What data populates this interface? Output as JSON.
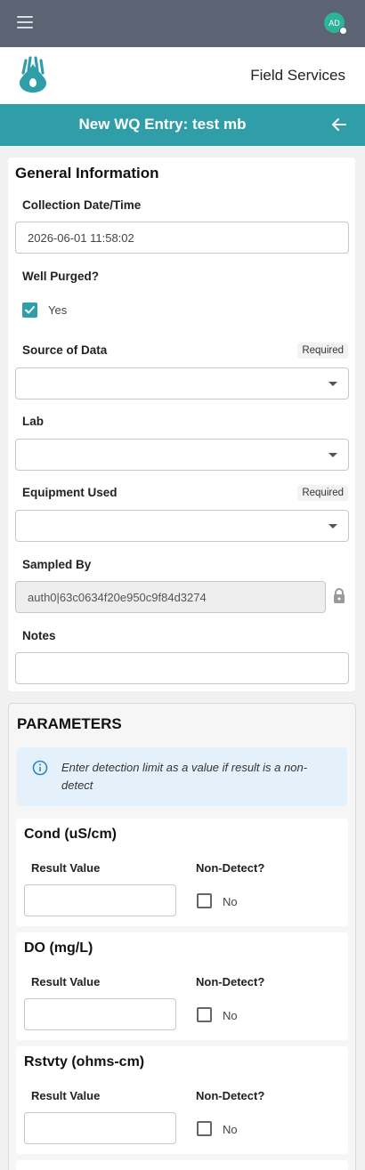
{
  "header": {
    "avatar_initials": "AD",
    "app_title": "Field Services"
  },
  "page": {
    "title": "New WQ Entry: test mb"
  },
  "general": {
    "title": "General Information",
    "collection_label": "Collection Date/Time",
    "collection_value": "2026-06-01 11:58:02",
    "well_purged_label": "Well Purged?",
    "well_purged_value": "Yes",
    "source_label": "Source of Data",
    "source_required": "Required",
    "lab_label": "Lab",
    "equipment_label": "Equipment Used",
    "equipment_required": "Required",
    "sampled_by_label": "Sampled By",
    "sampled_by_value": "auth0|63c0634f20e950c9f84d3274",
    "notes_label": "Notes"
  },
  "parameters": {
    "title": "PARAMETERS",
    "info": "Enter detection limit as a value if result is a non-detect",
    "items": [
      {
        "name": "Cond (uS/cm)",
        "result_label": "Result Value",
        "nd_label": "Non-Detect?",
        "nd_value": "No"
      },
      {
        "name": "DO (mg/L)",
        "result_label": "Result Value",
        "nd_label": "Non-Detect?",
        "nd_value": "No"
      },
      {
        "name": "Rstvty (ohms-cm)",
        "result_label": "Result Value",
        "nd_label": "Non-Detect?",
        "nd_value": "No"
      }
    ]
  },
  "colors": {
    "top_bar": "#5c6373",
    "accent": "#2f9ea9",
    "avatar": "#2ab59a",
    "info_bg": "#e4f1fb"
  }
}
